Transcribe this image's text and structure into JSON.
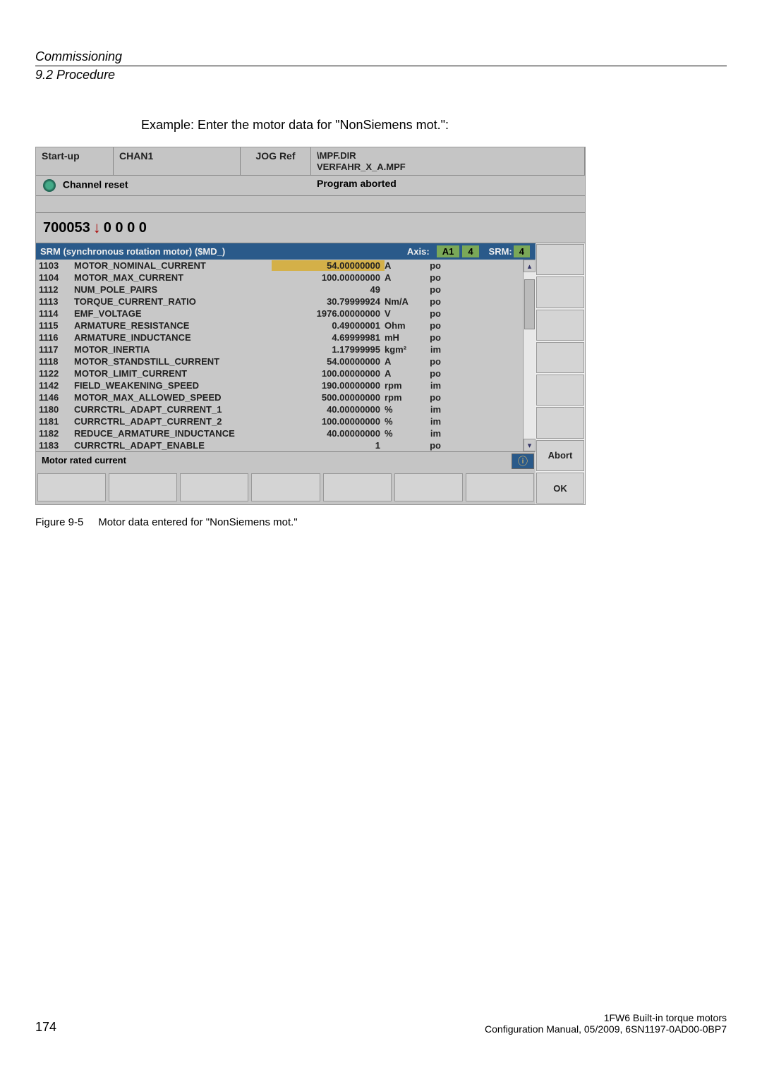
{
  "doc": {
    "title": "Commissioning",
    "subtitle": "9.2 Procedure",
    "example_text": "Example: Enter the motor data for \"NonSiemens mot.\":",
    "figure_caption_label": "Figure 9-5",
    "figure_caption_text": "Motor data entered for \"NonSiemens mot.\"",
    "page_num": "174",
    "footer_line1": "1FW6 Built-in torque motors",
    "footer_line2": "Configuration Manual, 05/2009, 6SN1197-0AD00-0BP7"
  },
  "hmi": {
    "mode": "Start-up",
    "channel": "CHAN1",
    "jog": "JOG Ref",
    "mpf_line1": "\\MPF.DIR",
    "mpf_line2": "VERFAHR_X_A.MPF",
    "channel_reset": "Channel reset",
    "program_aborted": "Program aborted",
    "code": "700053",
    "code_zeros": "0 0 0 0",
    "srm_title": "SRM (synchronous rotation motor) ($MD_)",
    "axis_label": "Axis:",
    "axis_name": "A1",
    "axis_num": "4",
    "srm_label": "SRM:",
    "srm_num": "4",
    "footer_status": "Motor rated current",
    "abort_btn": "Abort",
    "ok_btn": "OK"
  },
  "rows": [
    {
      "id": "1103",
      "name": "MOTOR_NOMINAL_CURRENT",
      "value": "54.00000000",
      "unit": "A",
      "attr": "po",
      "highlight": true
    },
    {
      "id": "1104",
      "name": "MOTOR_MAX_CURRENT",
      "value": "100.00000000",
      "unit": "A",
      "attr": "po"
    },
    {
      "id": "1112",
      "name": "NUM_POLE_PAIRS",
      "value": "49",
      "unit": "",
      "attr": "po"
    },
    {
      "id": "1113",
      "name": "TORQUE_CURRENT_RATIO",
      "value": "30.79999924",
      "unit": "Nm/A",
      "attr": "po"
    },
    {
      "id": "1114",
      "name": "EMF_VOLTAGE",
      "value": "1976.00000000",
      "unit": "V",
      "attr": "po"
    },
    {
      "id": "1115",
      "name": "ARMATURE_RESISTANCE",
      "value": "0.49000001",
      "unit": "Ohm",
      "attr": "po"
    },
    {
      "id": "1116",
      "name": "ARMATURE_INDUCTANCE",
      "value": "4.69999981",
      "unit": "mH",
      "attr": "po"
    },
    {
      "id": "1117",
      "name": "MOTOR_INERTIA",
      "value": "1.17999995",
      "unit": "kgm²",
      "attr": "im"
    },
    {
      "id": "1118",
      "name": "MOTOR_STANDSTILL_CURRENT",
      "value": "54.00000000",
      "unit": "A",
      "attr": "po"
    },
    {
      "id": "1122",
      "name": "MOTOR_LIMIT_CURRENT",
      "value": "100.00000000",
      "unit": "A",
      "attr": "po"
    },
    {
      "id": "1142",
      "name": "FIELD_WEAKENING_SPEED",
      "value": "190.00000000",
      "unit": "rpm",
      "attr": "im"
    },
    {
      "id": "1146",
      "name": "MOTOR_MAX_ALLOWED_SPEED",
      "value": "500.00000000",
      "unit": "rpm",
      "attr": "po"
    },
    {
      "id": "1180",
      "name": "CURRCTRL_ADAPT_CURRENT_1",
      "value": "40.00000000",
      "unit": "%",
      "attr": "im"
    },
    {
      "id": "1181",
      "name": "CURRCTRL_ADAPT_CURRENT_2",
      "value": "100.00000000",
      "unit": "%",
      "attr": "im"
    },
    {
      "id": "1182",
      "name": "REDUCE_ARMATURE_INDUCTANCE",
      "value": "40.00000000",
      "unit": "%",
      "attr": "im"
    },
    {
      "id": "1183",
      "name": "CURRCTRL_ADAPT_ENABLE",
      "value": "1",
      "unit": "",
      "attr": "po"
    }
  ]
}
